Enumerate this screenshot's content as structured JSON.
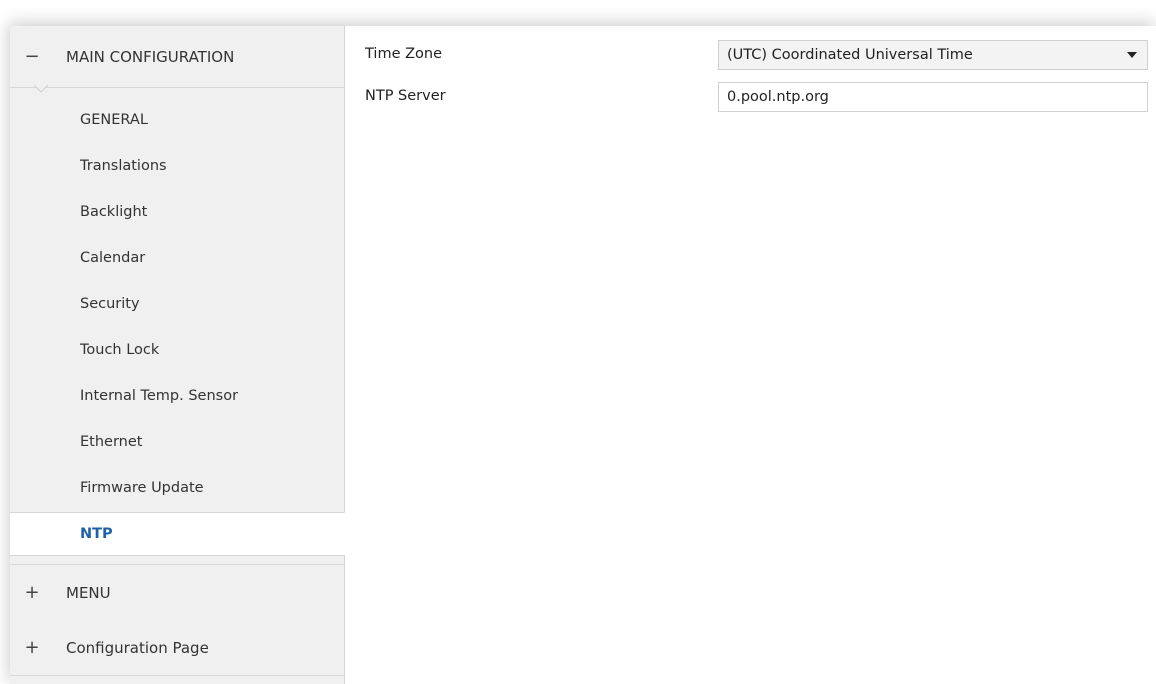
{
  "sidebar": {
    "main_section": {
      "label": "MAIN CONFIGURATION",
      "sign": "−"
    },
    "items": [
      {
        "label": "GENERAL"
      },
      {
        "label": "Translations"
      },
      {
        "label": "Backlight"
      },
      {
        "label": "Calendar"
      },
      {
        "label": "Security"
      },
      {
        "label": "Touch Lock"
      },
      {
        "label": "Internal Temp. Sensor"
      },
      {
        "label": "Ethernet"
      },
      {
        "label": "Firmware Update"
      },
      {
        "label": "NTP"
      }
    ],
    "menu_section": {
      "label": "MENU",
      "sign": "+"
    },
    "config_section": {
      "label": "Configuration Page",
      "sign": "+"
    }
  },
  "main": {
    "time_zone": {
      "label": "Time Zone",
      "value": "(UTC) Coordinated Universal Time"
    },
    "ntp_server": {
      "label": "NTP Server",
      "value": "0.pool.ntp.org"
    }
  },
  "colors": {
    "selected_text": "#1f5fa8",
    "sidebar_bg": "#f0f0f0"
  }
}
